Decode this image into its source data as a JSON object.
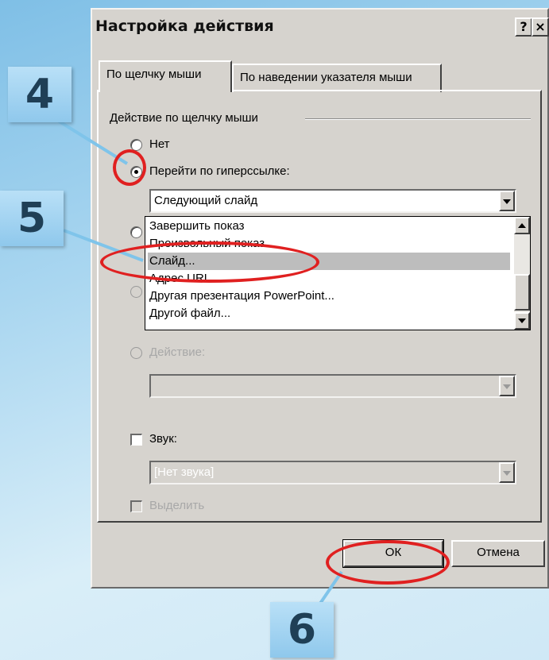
{
  "dialog": {
    "title": "Настройка действия",
    "help_label": "?",
    "close_label": "×"
  },
  "tabs": [
    {
      "label": "По щелчку мыши",
      "active": true
    },
    {
      "label": "По наведении указателя мыши",
      "active": false
    }
  ],
  "group": {
    "label": "Действие по щелчку мыши"
  },
  "options": {
    "none": "Нет",
    "hyperlink": "Перейти по гиперссылке:",
    "action": "Действие:"
  },
  "hyperlink_combo": {
    "value": "Следующий слайд"
  },
  "dropdown": {
    "items": [
      "Завершить показ",
      "Произвольный показ...",
      "Слайд...",
      "Адрес URL...",
      "Другая презентация PowerPoint...",
      "Другой файл..."
    ],
    "selected_index": 2
  },
  "action_combo": {
    "value": ""
  },
  "sound": {
    "label": "Звук:",
    "value": "[Нет звука]"
  },
  "highlight": {
    "label": "Выделить"
  },
  "buttons": {
    "ok": "ОК",
    "cancel": "Отмена"
  },
  "badges": [
    "4",
    "5",
    "6"
  ],
  "colors": {
    "dialog_bg": "#d6d3ce",
    "highlight_ring": "#e02020",
    "badge_bg": "#8fc8ec",
    "selection": "#bdbdbd"
  }
}
